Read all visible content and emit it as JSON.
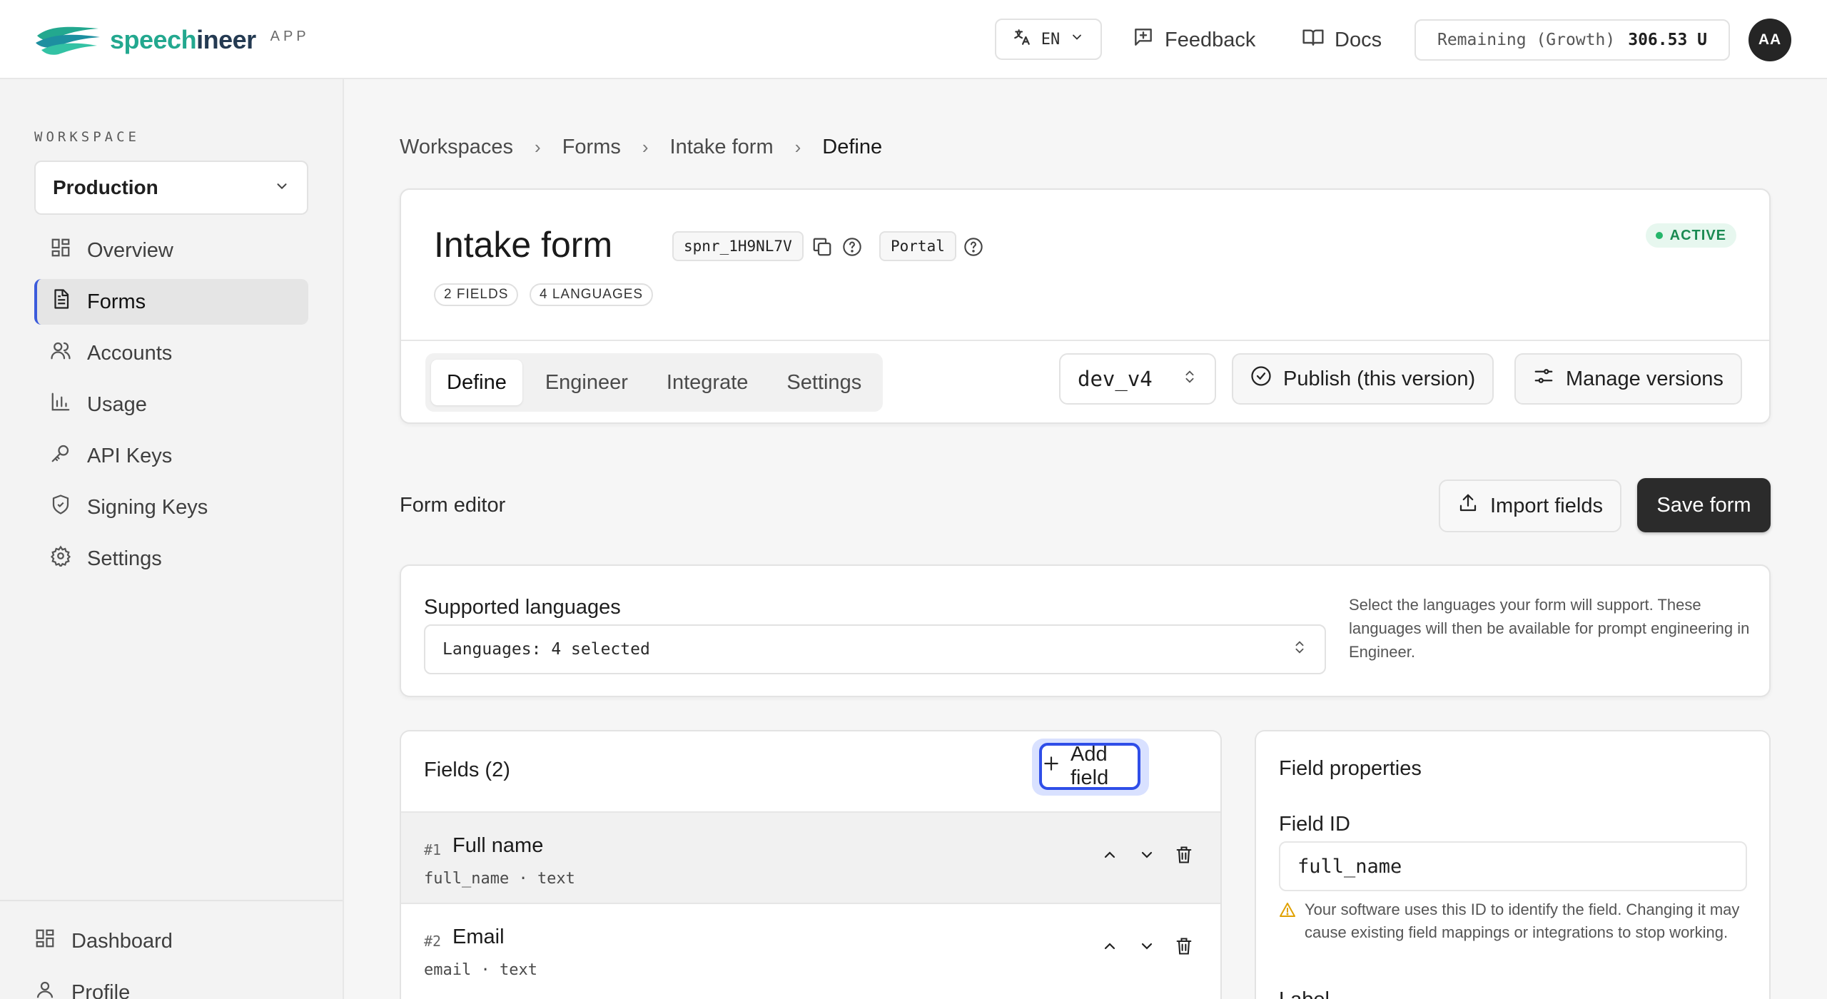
{
  "brand": {
    "name_part1": "speech",
    "name_part2": "ineer",
    "suffix": "APP"
  },
  "topbar": {
    "language": "EN",
    "feedback_label": "Feedback",
    "docs_label": "Docs",
    "remaining_label": "Remaining (Growth)",
    "remaining_value": "306.53 U",
    "avatar_initials": "AA"
  },
  "sidebar": {
    "workspace_label": "WORKSPACE",
    "workspace_selected": "Production",
    "items": [
      {
        "label": "Overview",
        "icon": "grid-icon"
      },
      {
        "label": "Forms",
        "icon": "document-icon",
        "active": true
      },
      {
        "label": "Accounts",
        "icon": "users-icon"
      },
      {
        "label": "Usage",
        "icon": "bar-chart-icon"
      },
      {
        "label": "API Keys",
        "icon": "key-icon"
      },
      {
        "label": "Signing Keys",
        "icon": "shield-icon"
      },
      {
        "label": "Settings",
        "icon": "gear-icon"
      }
    ],
    "bottom_items": [
      {
        "label": "Dashboard",
        "icon": "grid-icon"
      },
      {
        "label": "Profile",
        "icon": "user-icon"
      }
    ]
  },
  "breadcrumb": [
    "Workspaces",
    "Forms",
    "Intake form",
    "Define"
  ],
  "form": {
    "title": "Intake form",
    "id": "spnr_1H9NL7V",
    "type": "Portal",
    "fields_pill": "2 FIELDS",
    "languages_pill": "4 LANGUAGES",
    "status": "ACTIVE",
    "status_color": "#1a8a52"
  },
  "tabs": [
    "Define",
    "Engineer",
    "Integrate",
    "Settings"
  ],
  "active_tab": "Define",
  "version": "dev_v4",
  "publish_label": "Publish (this version)",
  "manage_versions_label": "Manage versions",
  "editor": {
    "title": "Form editor",
    "import_label": "Import fields",
    "save_label": "Save form"
  },
  "languages": {
    "label": "Supported languages",
    "select_prefix": "Languages:",
    "select_value": "4 selected",
    "help": "Select the languages your form will support. These languages will then be available for prompt engineering in Engineer."
  },
  "fields_panel": {
    "title": "Fields (2)",
    "add_label": "Add field",
    "accent": "#2f4ee8",
    "rows": [
      {
        "num": "#1",
        "name": "Full name",
        "meta": "full_name · text",
        "selected": true
      },
      {
        "num": "#2",
        "name": "Email",
        "meta": "email · text",
        "selected": false
      }
    ]
  },
  "properties": {
    "title": "Field properties",
    "id_label": "Field ID",
    "id_value": "full_name",
    "warning": "Your software uses this ID to identify the field. Changing it may cause existing field mappings or integrations to stop working.",
    "next_label": "Label"
  }
}
